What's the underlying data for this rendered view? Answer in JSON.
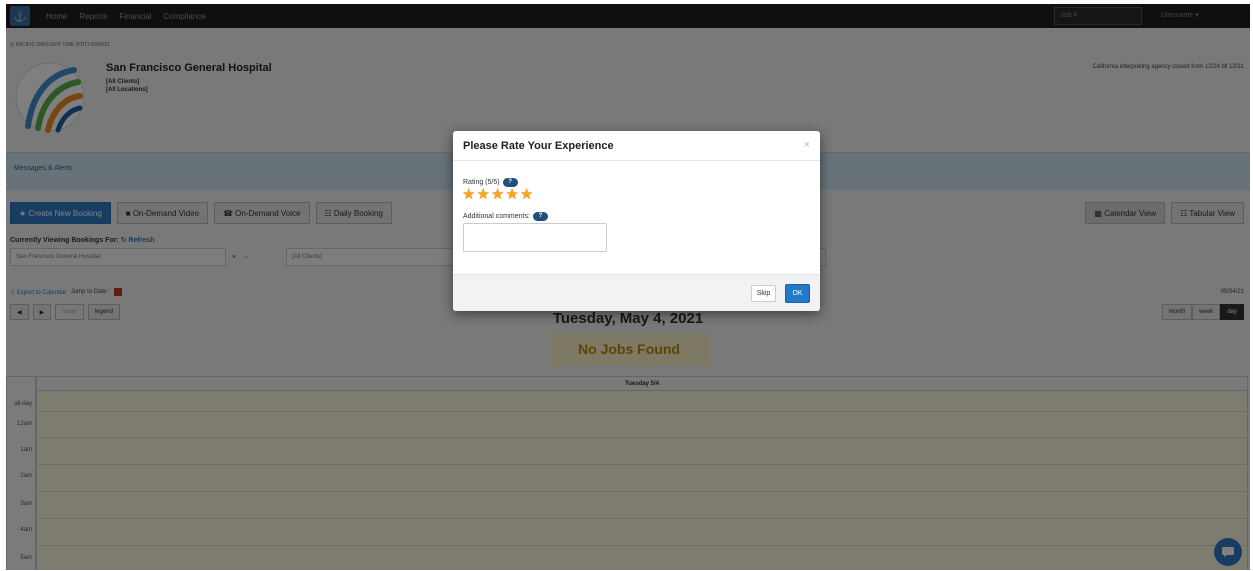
{
  "nav": {
    "logo_glyph": "⚓",
    "links": [
      "Home",
      "Reports",
      "Financial",
      "Compliance"
    ],
    "job_placeholder": "Job #",
    "user_label": "Username ▾"
  },
  "header": {
    "timezone": "◷ PACIFIC DAYLIGHT TIME (PDT) 05/04/21",
    "org_name": "San Francisco General Hospital",
    "clients": "[All Clients]",
    "locations": "[All Locations]",
    "closure_notice": "California interpreting agency closed from 12/24 till 12/31"
  },
  "alerts": {
    "label": "Messages & Alerts"
  },
  "toolbar": {
    "create": "★ Create New Booking",
    "video": "■ On-Demand Video",
    "voice": "☎ On-Demand Voice",
    "daily": "☷ Daily Booking",
    "calendar_view": "▦ Calendar View",
    "tabular_view": "☷ Tabular View"
  },
  "filters": {
    "viewing_label": "Currently Viewing Bookings For:",
    "refresh": "↻ Refresh",
    "facility_value": "San Francisco General Hospital",
    "clear": "×",
    "caret": "⌵",
    "clients_value": "[All Clients]"
  },
  "calendar": {
    "export": "⇪ Export to Calendar",
    "jump_to": "Jump to Date :",
    "current_date": "05/04/21",
    "prev": "◀",
    "next": "▶",
    "today": "today",
    "legend": "legend",
    "ranges": [
      "month",
      "week",
      "day"
    ],
    "day_title": "Tuesday, May 4, 2021",
    "no_jobs": "No Jobs Found",
    "column_header": "Tuesday 5/4",
    "time_labels": [
      "all-day",
      "12am",
      "1am",
      "2am",
      "3am",
      "4am",
      "5am"
    ]
  },
  "modal": {
    "title": "Please Rate Your Experience",
    "close": "×",
    "rating_label": "Rating (5/5)",
    "help": "?",
    "rating": 5,
    "rating_max": 5,
    "star_glyph": "★",
    "comments_label": "Additional comments:",
    "comments_value": "",
    "skip": "Skip",
    "ok": "OK"
  },
  "colors": {
    "accent": "#2278c9",
    "star": "#f5a623",
    "nav_bg": "#1f1f1f",
    "alerts_bg": "#cfe6f1",
    "calendar_bg": "#fcf8e3"
  }
}
